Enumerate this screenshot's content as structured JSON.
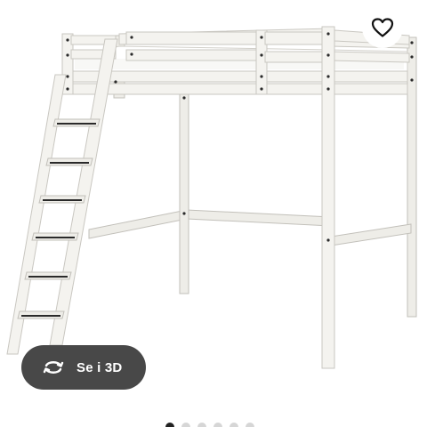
{
  "product_image": {
    "icon": "white-loft-bed-frame-with-ladder"
  },
  "favorite": {
    "icon": "heart-outline-icon"
  },
  "view_3d": {
    "label": "Se i 3D",
    "icon": "rotate-arrows-icon"
  },
  "carousel": {
    "dot_count": 6,
    "active_index": 0
  },
  "colors": {
    "pill_background": "#484848",
    "active_dot": "#222222",
    "inactive_dot": "#d6d6d6",
    "bed_frame": "#f3f2ee"
  }
}
